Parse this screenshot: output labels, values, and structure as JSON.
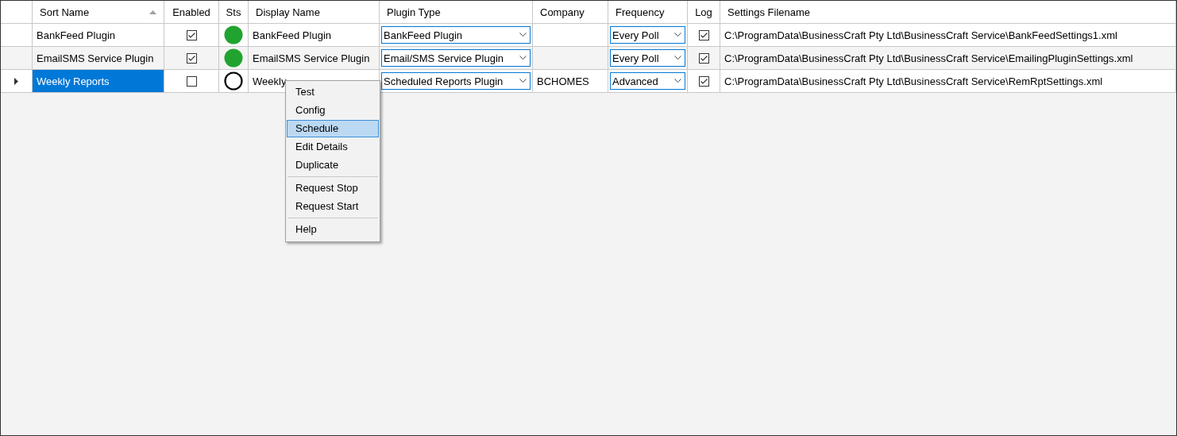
{
  "grid": {
    "columns": [
      {
        "label": "Sort Name",
        "sorted": true
      },
      {
        "label": "Enabled",
        "sorted": false
      },
      {
        "label": "Sts",
        "sorted": false
      },
      {
        "label": "Display Name",
        "sorted": false
      },
      {
        "label": "Plugin Type",
        "sorted": false
      },
      {
        "label": "Company",
        "sorted": false
      },
      {
        "label": "Frequency",
        "sorted": false
      },
      {
        "label": "Log",
        "sorted": false
      },
      {
        "label": "Settings Filename",
        "sorted": false
      }
    ],
    "rows": [
      {
        "selected": false,
        "sort_name": "BankFeed Plugin",
        "enabled": true,
        "running": true,
        "display_name": "BankFeed Plugin",
        "plugin_type": "BankFeed Plugin",
        "company": "",
        "frequency": "Every Poll",
        "log": true,
        "settings_filename": "C:\\ProgramData\\BusinessCraft Pty Ltd\\BusinessCraft Service\\BankFeedSettings1.xml"
      },
      {
        "selected": false,
        "sort_name": "EmailSMS Service Plugin",
        "enabled": true,
        "running": true,
        "display_name": "EmailSMS Service Plugin",
        "plugin_type": "Email/SMS Service Plugin",
        "company": "",
        "frequency": "Every Poll",
        "log": true,
        "settings_filename": "C:\\ProgramData\\BusinessCraft Pty Ltd\\BusinessCraft Service\\EmailingPluginSettings.xml"
      },
      {
        "selected": true,
        "sort_name": "Weekly Reports",
        "enabled": false,
        "running": false,
        "display_name": "Weekly",
        "plugin_type": "Scheduled Reports Plugin",
        "company": "BCHOMES",
        "frequency": "Advanced",
        "log": true,
        "settings_filename": "C:\\ProgramData\\BusinessCraft Pty Ltd\\BusinessCraft Service\\RemRptSettings.xml"
      }
    ]
  },
  "context_menu": {
    "groups": [
      [
        {
          "label": "Test",
          "selected": false
        },
        {
          "label": "Config",
          "selected": false
        },
        {
          "label": "Schedule",
          "selected": true
        },
        {
          "label": "Edit Details",
          "selected": false
        },
        {
          "label": "Duplicate",
          "selected": false
        }
      ],
      [
        {
          "label": "Request Stop",
          "selected": false
        },
        {
          "label": "Request Start",
          "selected": false
        }
      ],
      [
        {
          "label": "Help",
          "selected": false
        }
      ]
    ]
  }
}
